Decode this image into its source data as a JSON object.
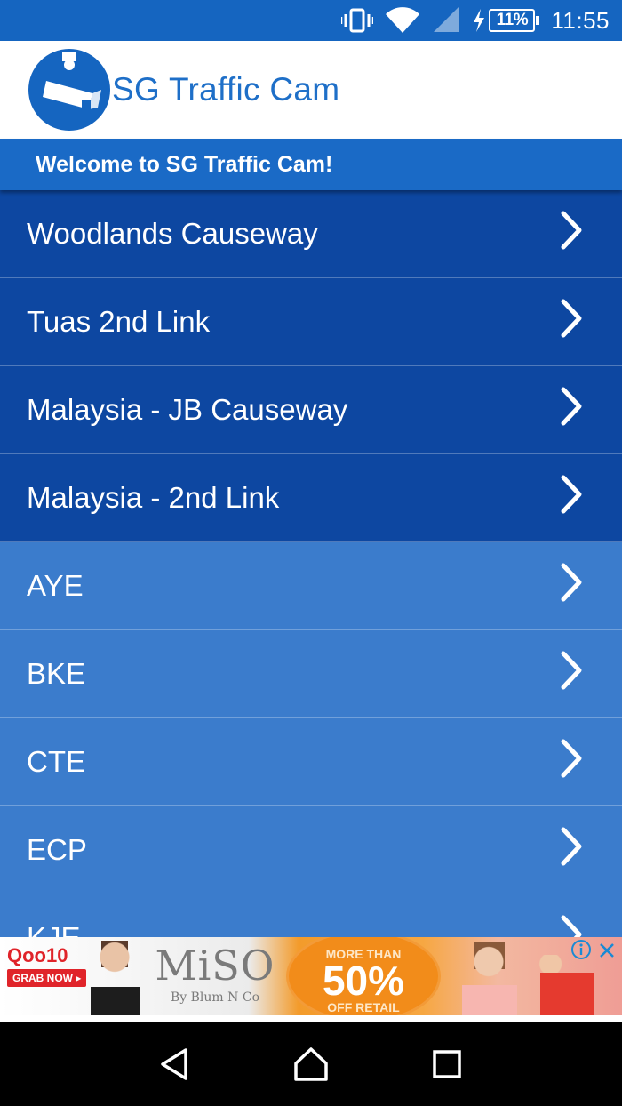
{
  "status_bar": {
    "battery_text": "11%",
    "time": "11:55",
    "icons": [
      "vibrate-icon",
      "wifi-icon",
      "signal-icon",
      "charging-icon",
      "battery-icon"
    ]
  },
  "header": {
    "title": "SG Traffic Cam",
    "logo_icon": "traffic-camera-icon"
  },
  "welcome": {
    "text": "Welcome to SG Traffic Cam!"
  },
  "list": {
    "items": [
      {
        "label": "Woodlands Causeway",
        "style": "dark"
      },
      {
        "label": "Tuas 2nd Link",
        "style": "dark"
      },
      {
        "label": "Malaysia - JB Causeway",
        "style": "dark"
      },
      {
        "label": "Malaysia - 2nd Link",
        "style": "dark"
      },
      {
        "label": "AYE",
        "style": "light"
      },
      {
        "label": "BKE",
        "style": "light"
      },
      {
        "label": "CTE",
        "style": "light"
      },
      {
        "label": "ECP",
        "style": "light"
      },
      {
        "label": "KJE",
        "style": "light"
      }
    ],
    "chevron_icon": "chevron-right-icon"
  },
  "ad": {
    "qoo_brand": "Qoo10",
    "qoo_cta": "GRAB NOW ▸",
    "brand_main": "MiSO",
    "brand_sub": "By Blum N Co",
    "promo_top": "MORE THAN",
    "promo_big": "50%",
    "promo_bottom": "OFF RETAIL"
  },
  "nav": {
    "icons": [
      "back-icon",
      "home-icon",
      "recents-icon"
    ]
  },
  "colors": {
    "primary": "#1565c0",
    "title_blue": "#1e6fc8",
    "dark_item": "#0d47a1",
    "light_item": "#3b7ccc"
  }
}
